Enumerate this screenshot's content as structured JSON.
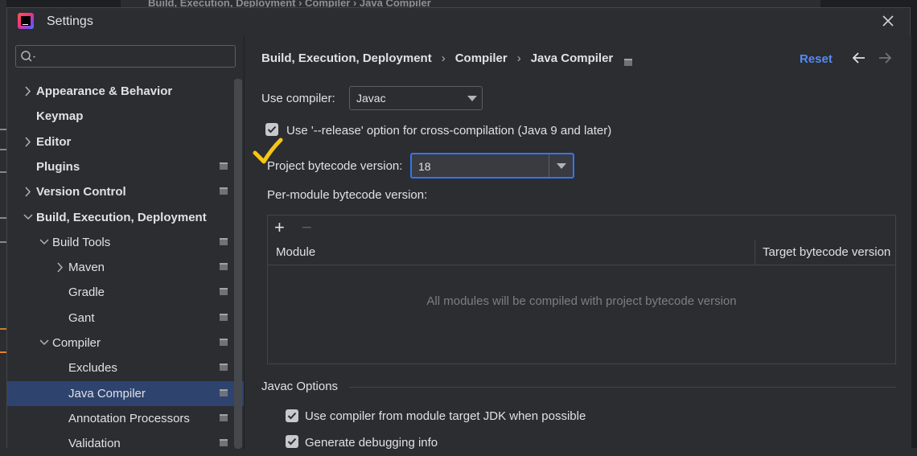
{
  "background_ide": {
    "top_crumb": "Build, Execution, Deployment › Compiler › Java Compiler"
  },
  "window": {
    "title": "Settings",
    "close_icon": "close-icon"
  },
  "sidebar": {
    "search_placeholder": "",
    "items": [
      {
        "label": "Appearance & Behavior",
        "level": 0,
        "arrow": "right",
        "bold": true,
        "page_icon": false
      },
      {
        "label": "Keymap",
        "level": 0,
        "arrow": "none",
        "bold": true,
        "page_icon": false
      },
      {
        "label": "Editor",
        "level": 0,
        "arrow": "right",
        "bold": true,
        "page_icon": false
      },
      {
        "label": "Plugins",
        "level": 0,
        "arrow": "none",
        "bold": true,
        "page_icon": true
      },
      {
        "label": "Version Control",
        "level": 0,
        "arrow": "right",
        "bold": true,
        "page_icon": true
      },
      {
        "label": "Build, Execution, Deployment",
        "level": 0,
        "arrow": "down",
        "bold": true,
        "page_icon": false
      },
      {
        "label": "Build Tools",
        "level": 1,
        "arrow": "down",
        "bold": false,
        "page_icon": true
      },
      {
        "label": "Maven",
        "level": 2,
        "arrow": "right",
        "bold": false,
        "page_icon": true
      },
      {
        "label": "Gradle",
        "level": 2,
        "arrow": "none",
        "bold": false,
        "page_icon": true
      },
      {
        "label": "Gant",
        "level": 2,
        "arrow": "none",
        "bold": false,
        "page_icon": true
      },
      {
        "label": "Compiler",
        "level": 1,
        "arrow": "down",
        "bold": false,
        "page_icon": true
      },
      {
        "label": "Excludes",
        "level": 2,
        "arrow": "none",
        "bold": false,
        "page_icon": true
      },
      {
        "label": "Java Compiler",
        "level": 2,
        "arrow": "none",
        "bold": false,
        "page_icon": true,
        "selected": true
      },
      {
        "label": "Annotation Processors",
        "level": 2,
        "arrow": "none",
        "bold": false,
        "page_icon": true
      },
      {
        "label": "Validation",
        "level": 2,
        "arrow": "none",
        "bold": false,
        "page_icon": true
      }
    ]
  },
  "main": {
    "breadcrumb": [
      "Build, Execution, Deployment",
      "Compiler",
      "Java Compiler"
    ],
    "reset_label": "Reset",
    "use_compiler_label": "Use compiler:",
    "use_compiler_value": "Javac",
    "release_option_label": "Use '--release' option for cross-compilation (Java 9 and later)",
    "release_option_checked": true,
    "bytecode_label": "Project bytecode version:",
    "bytecode_value": "18",
    "per_module_label": "Per-module bytecode version:",
    "table": {
      "add_label": "+",
      "remove_label": "−",
      "col_module": "Module",
      "col_target": "Target bytecode version",
      "empty_text": "All modules will be compiled with project bytecode version"
    },
    "javac_section_label": "Javac Options",
    "javac_options": [
      {
        "label": "Use compiler from module target JDK when possible",
        "checked": true
      },
      {
        "label": "Generate debugging info",
        "checked": true
      }
    ]
  },
  "colors": {
    "accent": "#548af7",
    "selection": "#2e436e",
    "annotation": "#f5c518"
  }
}
